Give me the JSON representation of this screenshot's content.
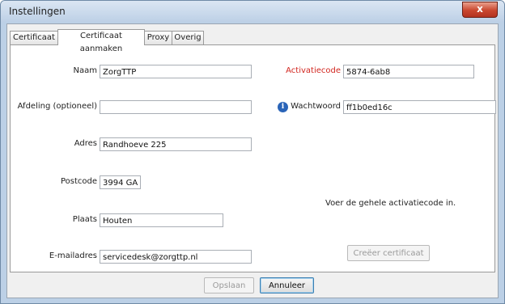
{
  "window": {
    "title": "Instellingen",
    "close_label": "x"
  },
  "tabs": [
    {
      "label": "Certificaat",
      "active": false
    },
    {
      "label": "Certificaat aanmaken",
      "active": true
    },
    {
      "label": "Proxy",
      "active": false
    },
    {
      "label": "Overig",
      "active": false
    }
  ],
  "form": {
    "naam": {
      "label": "Naam",
      "value": "ZorgTTP"
    },
    "afdeling": {
      "label": "Afdeling (optioneel)",
      "value": ""
    },
    "adres": {
      "label": "Adres",
      "value": "Randhoeve 225"
    },
    "postcode": {
      "label": "Postcode",
      "value": "3994 GA"
    },
    "plaats": {
      "label": "Plaats",
      "value": "Houten"
    },
    "email": {
      "label": "E-mailadres",
      "value": "servicedesk@zorgttp.nl"
    },
    "activatiecode": {
      "label": "Activatiecode",
      "value": "5874-6ab8",
      "label_color": "#d2261f"
    },
    "wachtwoord": {
      "label": "Wachtwoord",
      "value": "ff1b0ed16c",
      "info_icon": "info-icon"
    },
    "hint": "Voer de gehele activatiecode in.",
    "create_button": "Creëer certificaat"
  },
  "footer": {
    "save": "Opslaan",
    "cancel": "Annuleer"
  }
}
